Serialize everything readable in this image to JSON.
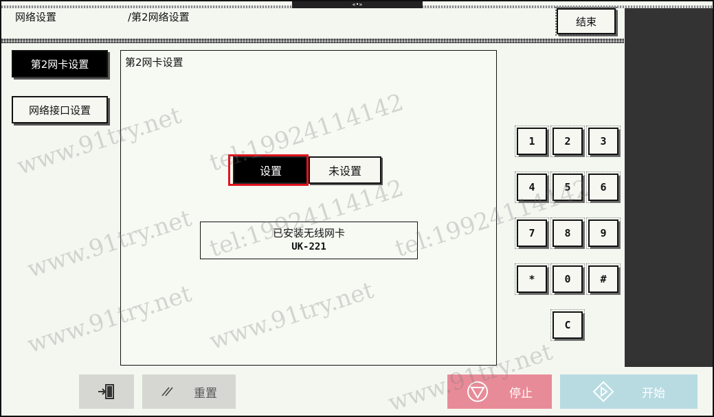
{
  "header": {
    "crumb_main": "网络设置",
    "crumb_sub": "/第2网络设置",
    "end_label": "结束",
    "grip_label": "«•»"
  },
  "sidebar": {
    "items": [
      {
        "label": "第2网卡设置",
        "active": true
      },
      {
        "label": "网络接口设置",
        "active": false
      }
    ]
  },
  "panel": {
    "title": "第2网卡设置",
    "options": [
      {
        "label": "设置",
        "selected": true
      },
      {
        "label": "未设置",
        "selected": false
      }
    ],
    "info_line1": "已安装无线网卡",
    "info_line2": "UK-221"
  },
  "keypad": {
    "keys": [
      "1",
      "2",
      "3",
      "4",
      "5",
      "6",
      "7",
      "8",
      "9",
      "*",
      "0",
      "#",
      "C"
    ]
  },
  "footer": {
    "reset_label": "重置",
    "stop_label": "停止",
    "start_label": "开始",
    "exit_icon": "exit-door-icon",
    "reset_icon": "slash-icon",
    "stop_icon": "stop-triangle-icon",
    "start_icon": "start-diamond-icon"
  },
  "colors": {
    "highlight": "#e0141e",
    "stop_bg": "#e88b98",
    "start_bg": "#b8dbe2"
  },
  "watermark": {
    "site": "www.91try.net",
    "phone": "tel:19924114142"
  }
}
